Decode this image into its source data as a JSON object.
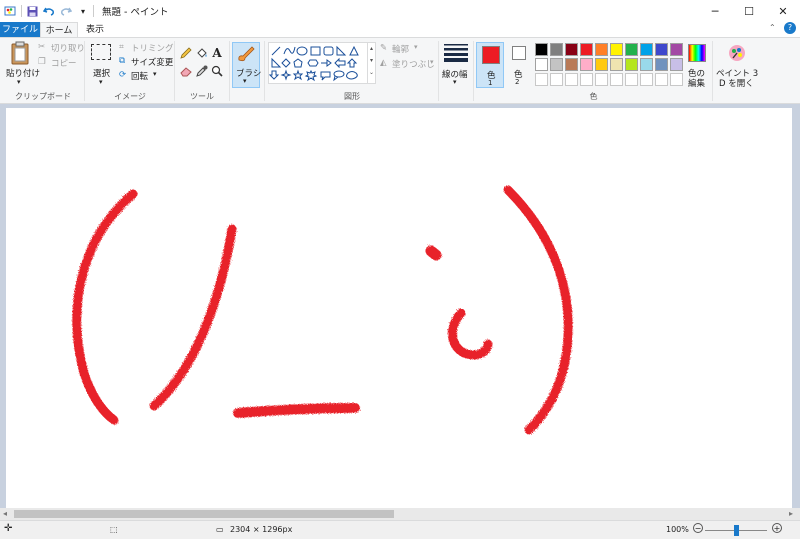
{
  "window": {
    "title": "無題 - ペイント",
    "minimize": "─",
    "maximize": "☐",
    "close": "✕"
  },
  "tabs": [
    "ファイル",
    "ホーム",
    "表示"
  ],
  "ribbon": {
    "clipboard": {
      "paste": "貼り付け",
      "cut": "切り取り",
      "copy": "コピー",
      "label": "クリップボード"
    },
    "image": {
      "select": "選択",
      "crop": "トリミング",
      "resize": "サイズ変更",
      "rotate": "回転",
      "label": "イメージ"
    },
    "tools": {
      "label": "ツール"
    },
    "brushes": {
      "label": "ブラシ"
    },
    "shapes": {
      "outline": "輪郭",
      "fill": "塗りつぶし",
      "label": "図形"
    },
    "size": {
      "label": "線の幅"
    },
    "colors": {
      "color1": "色",
      "color1_num": "1",
      "color2": "色",
      "color2_num": "2",
      "edit_line1": "色の",
      "edit_line2": "編集",
      "paint3d_line1": "ペイント 3",
      "paint3d_line2": "D を開く",
      "label": "色",
      "color1_value": "#ed1c24",
      "color2_value": "#ffffff",
      "palette": [
        "#000000",
        "#7f7f7f",
        "#880015",
        "#ed1c24",
        "#ff7f27",
        "#fff200",
        "#22b14c",
        "#00a2e8",
        "#3f48cc",
        "#a349a4",
        "#ffffff",
        "#c3c3c3",
        "#b97a57",
        "#ffaec9",
        "#ffc90e",
        "#efe4b0",
        "#b5e61d",
        "#99d9ea",
        "#7092be",
        "#c8bfe7",
        "#ffffff",
        "#ffffff",
        "#ffffff",
        "#ffffff",
        "#ffffff",
        "#ffffff",
        "#ffffff",
        "#ffffff",
        "#ffffff",
        "#ffffff"
      ]
    }
  },
  "status": {
    "dimensions": "2304 × 1296px",
    "zoom": "100%",
    "zoom_out": "−",
    "zoom_in": "+"
  },
  "drawing_color": "#e8202a"
}
